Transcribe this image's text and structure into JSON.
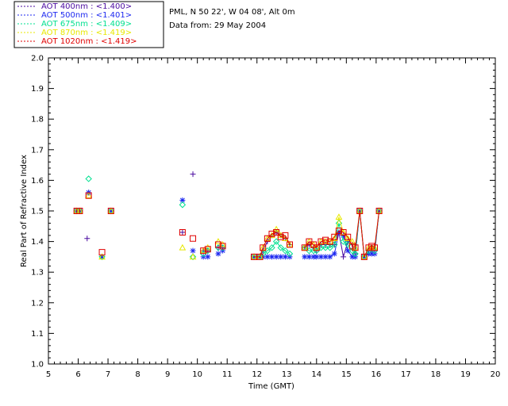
{
  "chart_data": {
    "type": "scatter",
    "title_lines": [
      "PML, N 50 22', W 04 08', Alt 0m",
      "Data from: 29 May 2004"
    ],
    "xlabel": "Time (GMT)",
    "ylabel": "Real Part of Refractive Index",
    "xlim": [
      5,
      20
    ],
    "ylim": [
      1.0,
      2.0
    ],
    "xticks": [
      5,
      6,
      7,
      8,
      9,
      10,
      11,
      12,
      13,
      14,
      15,
      16,
      17,
      18,
      19,
      20
    ],
    "yticks": [
      1.0,
      1.1,
      1.2,
      1.3,
      1.4,
      1.5,
      1.6,
      1.7,
      1.8,
      1.9,
      2.0
    ],
    "grid": false,
    "legend_position": "top-left",
    "series": [
      {
        "name": "AOT  400nm : <1.400>",
        "color": "#4a0aa0",
        "marker": "plus",
        "points": [
          [
            5.95,
            1.5
          ],
          [
            6.05,
            1.5
          ],
          [
            6.3,
            1.41
          ],
          [
            6.35,
            1.56
          ],
          [
            6.8,
            1.35
          ],
          [
            7.1,
            1.5
          ],
          [
            9.5,
            1.43
          ],
          [
            9.85,
            1.62
          ],
          [
            10.2,
            1.37
          ],
          [
            10.35,
            1.37
          ],
          [
            10.7,
            1.38
          ],
          [
            10.85,
            1.38
          ],
          [
            11.9,
            1.35
          ],
          [
            12.1,
            1.35
          ],
          [
            12.2,
            1.37
          ],
          [
            12.35,
            1.4
          ],
          [
            12.5,
            1.42
          ],
          [
            12.65,
            1.43
          ],
          [
            12.8,
            1.42
          ],
          [
            12.95,
            1.41
          ],
          [
            13.1,
            1.39
          ],
          [
            13.6,
            1.38
          ],
          [
            13.75,
            1.39
          ],
          [
            13.9,
            1.38
          ],
          [
            14.0,
            1.37
          ],
          [
            14.15,
            1.39
          ],
          [
            14.3,
            1.39
          ],
          [
            14.45,
            1.39
          ],
          [
            14.6,
            1.39
          ],
          [
            14.75,
            1.43
          ],
          [
            14.9,
            1.35
          ],
          [
            15.05,
            1.4
          ],
          [
            15.2,
            1.39
          ],
          [
            15.3,
            1.36
          ],
          [
            15.45,
            1.5
          ],
          [
            15.6,
            1.35
          ],
          [
            15.75,
            1.37
          ],
          [
            15.85,
            1.37
          ],
          [
            15.95,
            1.37
          ],
          [
            16.1,
            1.5
          ]
        ]
      },
      {
        "name": "AOT  500nm : <1.401>",
        "color": "#1c28f0",
        "marker": "asterisk",
        "points": [
          [
            5.95,
            1.5
          ],
          [
            6.05,
            1.5
          ],
          [
            6.35,
            1.56
          ],
          [
            6.8,
            1.35
          ],
          [
            7.1,
            1.5
          ],
          [
            9.5,
            1.535
          ],
          [
            9.85,
            1.37
          ],
          [
            10.2,
            1.35
          ],
          [
            10.35,
            1.35
          ],
          [
            10.7,
            1.36
          ],
          [
            10.85,
            1.37
          ],
          [
            11.9,
            1.35
          ],
          [
            12.1,
            1.35
          ],
          [
            12.2,
            1.35
          ],
          [
            12.35,
            1.35
          ],
          [
            12.5,
            1.35
          ],
          [
            12.65,
            1.35
          ],
          [
            12.8,
            1.35
          ],
          [
            12.95,
            1.35
          ],
          [
            13.1,
            1.35
          ],
          [
            13.6,
            1.35
          ],
          [
            13.75,
            1.35
          ],
          [
            13.9,
            1.35
          ],
          [
            14.0,
            1.35
          ],
          [
            14.15,
            1.35
          ],
          [
            14.3,
            1.35
          ],
          [
            14.45,
            1.35
          ],
          [
            14.6,
            1.36
          ],
          [
            14.75,
            1.43
          ],
          [
            14.9,
            1.42
          ],
          [
            15.05,
            1.37
          ],
          [
            15.2,
            1.35
          ],
          [
            15.3,
            1.35
          ],
          [
            15.45,
            1.5
          ],
          [
            15.6,
            1.35
          ],
          [
            15.75,
            1.36
          ],
          [
            15.85,
            1.36
          ],
          [
            15.95,
            1.36
          ],
          [
            16.1,
            1.5
          ]
        ]
      },
      {
        "name": "AOT  675nm : <1.409>",
        "color": "#00e090",
        "marker": "diamond",
        "points": [
          [
            5.95,
            1.5
          ],
          [
            6.05,
            1.5
          ],
          [
            6.35,
            1.605
          ],
          [
            6.8,
            1.35
          ],
          [
            7.1,
            1.5
          ],
          [
            9.5,
            1.52
          ],
          [
            9.85,
            1.35
          ],
          [
            10.2,
            1.36
          ],
          [
            10.35,
            1.37
          ],
          [
            10.7,
            1.38
          ],
          [
            10.85,
            1.38
          ],
          [
            11.9,
            1.35
          ],
          [
            12.1,
            1.35
          ],
          [
            12.2,
            1.36
          ],
          [
            12.35,
            1.37
          ],
          [
            12.5,
            1.38
          ],
          [
            12.65,
            1.4
          ],
          [
            12.8,
            1.38
          ],
          [
            12.95,
            1.37
          ],
          [
            13.1,
            1.36
          ],
          [
            13.6,
            1.38
          ],
          [
            13.75,
            1.37
          ],
          [
            13.9,
            1.37
          ],
          [
            14.0,
            1.37
          ],
          [
            14.15,
            1.38
          ],
          [
            14.3,
            1.38
          ],
          [
            14.45,
            1.38
          ],
          [
            14.6,
            1.39
          ],
          [
            14.75,
            1.46
          ],
          [
            14.9,
            1.4
          ],
          [
            15.05,
            1.39
          ],
          [
            15.2,
            1.37
          ],
          [
            15.3,
            1.36
          ],
          [
            15.45,
            1.5
          ],
          [
            15.6,
            1.35
          ],
          [
            15.75,
            1.37
          ],
          [
            15.85,
            1.38
          ],
          [
            15.95,
            1.37
          ],
          [
            16.1,
            1.5
          ]
        ]
      },
      {
        "name": "AOT  870nm : <1.419>",
        "color": "#e8e800",
        "marker": "triangle",
        "points": [
          [
            5.95,
            1.5
          ],
          [
            6.05,
            1.5
          ],
          [
            6.35,
            1.55
          ],
          [
            6.8,
            1.35
          ],
          [
            7.1,
            1.5
          ],
          [
            9.5,
            1.38
          ],
          [
            9.85,
            1.35
          ],
          [
            10.2,
            1.37
          ],
          [
            10.35,
            1.38
          ],
          [
            10.7,
            1.4
          ],
          [
            10.85,
            1.39
          ],
          [
            11.9,
            1.35
          ],
          [
            12.1,
            1.35
          ],
          [
            12.2,
            1.38
          ],
          [
            12.35,
            1.41
          ],
          [
            12.5,
            1.42
          ],
          [
            12.65,
            1.44
          ],
          [
            12.8,
            1.42
          ],
          [
            12.95,
            1.41
          ],
          [
            13.1,
            1.39
          ],
          [
            13.6,
            1.38
          ],
          [
            13.75,
            1.4
          ],
          [
            13.9,
            1.39
          ],
          [
            14.0,
            1.38
          ],
          [
            14.15,
            1.4
          ],
          [
            14.3,
            1.4
          ],
          [
            14.45,
            1.4
          ],
          [
            14.6,
            1.41
          ],
          [
            14.75,
            1.48
          ],
          [
            14.9,
            1.43
          ],
          [
            15.05,
            1.41
          ],
          [
            15.2,
            1.4
          ],
          [
            15.3,
            1.38
          ],
          [
            15.45,
            1.5
          ],
          [
            15.6,
            1.35
          ],
          [
            15.75,
            1.38
          ],
          [
            15.85,
            1.38
          ],
          [
            15.95,
            1.38
          ],
          [
            16.1,
            1.5
          ]
        ]
      },
      {
        "name": "AOT 1020nm : <1.419>",
        "color": "#e00000",
        "marker": "square",
        "points": [
          [
            5.95,
            1.5
          ],
          [
            6.05,
            1.5
          ],
          [
            6.35,
            1.55
          ],
          [
            6.8,
            1.365
          ],
          [
            7.1,
            1.5
          ],
          [
            9.5,
            1.43
          ],
          [
            9.85,
            1.41
          ],
          [
            10.2,
            1.37
          ],
          [
            10.35,
            1.375
          ],
          [
            10.7,
            1.39
          ],
          [
            10.85,
            1.385
          ],
          [
            11.9,
            1.35
          ],
          [
            12.1,
            1.35
          ],
          [
            12.2,
            1.38
          ],
          [
            12.35,
            1.41
          ],
          [
            12.5,
            1.425
          ],
          [
            12.65,
            1.43
          ],
          [
            12.8,
            1.415
          ],
          [
            12.95,
            1.42
          ],
          [
            13.1,
            1.39
          ],
          [
            13.6,
            1.38
          ],
          [
            13.75,
            1.4
          ],
          [
            13.9,
            1.39
          ],
          [
            14.0,
            1.38
          ],
          [
            14.15,
            1.4
          ],
          [
            14.3,
            1.405
          ],
          [
            14.45,
            1.4
          ],
          [
            14.6,
            1.415
          ],
          [
            14.75,
            1.435
          ],
          [
            14.9,
            1.43
          ],
          [
            15.05,
            1.415
          ],
          [
            15.2,
            1.385
          ],
          [
            15.3,
            1.38
          ],
          [
            15.45,
            1.5
          ],
          [
            15.6,
            1.35
          ],
          [
            15.75,
            1.38
          ],
          [
            15.85,
            1.385
          ],
          [
            15.95,
            1.38
          ],
          [
            16.1,
            1.5
          ]
        ]
      }
    ]
  }
}
